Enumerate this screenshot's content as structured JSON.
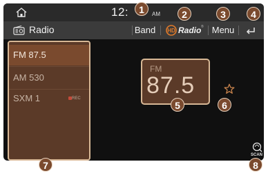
{
  "status_bar": {
    "clock": "12:",
    "am_pm": "AM"
  },
  "title_bar": {
    "title": "Radio",
    "band_label": "Band",
    "hd_radio_label": "Radio",
    "hd_radio_tm": "®",
    "menu_label": "Menu"
  },
  "station_list": {
    "items": [
      {
        "label": "FM 87.5",
        "selected": true
      },
      {
        "label": "AM 530",
        "selected": false
      },
      {
        "label": "SXM 1",
        "selected": false,
        "badge": "REC"
      }
    ]
  },
  "frequency": {
    "band": "FM",
    "value": "87.5"
  },
  "scan": {
    "label": "SCAN"
  },
  "callouts": [
    "1",
    "2",
    "3",
    "4",
    "5",
    "6",
    "7",
    "8"
  ],
  "colors": {
    "accent": "#7a4a2e",
    "panel": "#5b3a28",
    "panel_border": "#d8b896",
    "background": "#101010",
    "title_bar": "#3b3b3b",
    "status_bar": "#2a2a2a"
  },
  "icons": {
    "home": "home-icon",
    "radio": "radio-icon",
    "hd_radio": "hd-radio-logo-icon",
    "back": "back-arrow-icon",
    "favorite": "star-icon",
    "scan": "scan-icon"
  }
}
